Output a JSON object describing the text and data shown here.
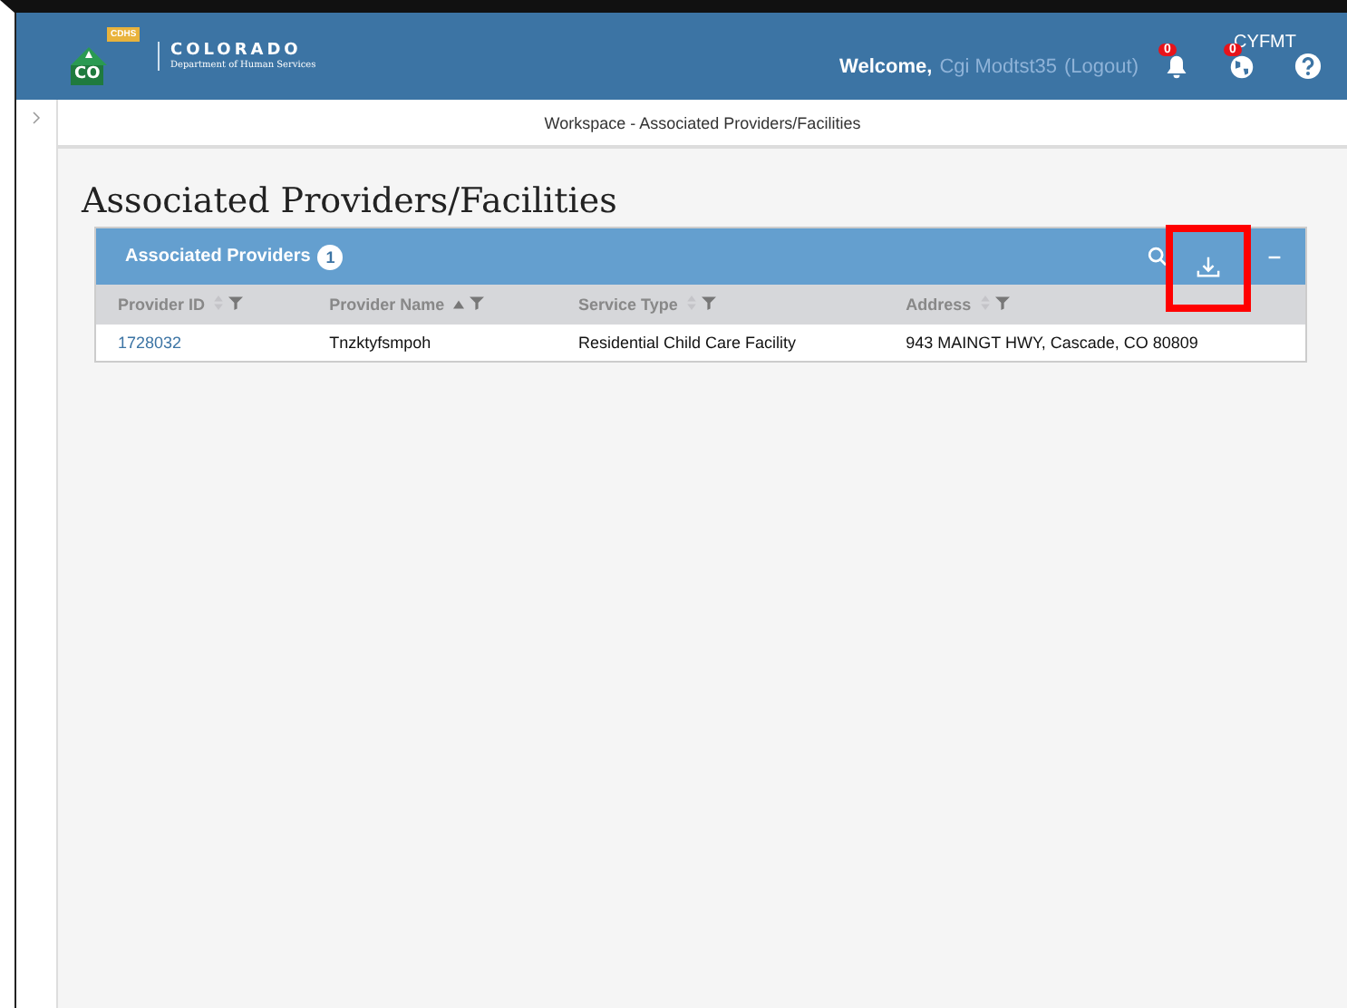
{
  "header": {
    "org_name": "COLORADO",
    "org_subtitle": "Department of Human Services",
    "logo_text": "CO",
    "logo_badge": "CDHS",
    "role": "CYFMT",
    "welcome": "Welcome,",
    "user_name": "Cgi Modtst35",
    "logout": "(Logout)",
    "notifications_count": "0",
    "globe_count": "0"
  },
  "breadcrumb": "Workspace - Associated Providers/Facilities",
  "page_title": "Associated Providers/Facilities",
  "panel": {
    "title": "Associated Providers",
    "count": "1",
    "tools": [
      {
        "kind": "search",
        "highlighted": false
      },
      {
        "kind": "download",
        "highlighted": true
      },
      {
        "kind": "collapse",
        "highlighted": false
      }
    ]
  },
  "table": {
    "columns": [
      {
        "label": "Provider ID",
        "sorted": false
      },
      {
        "label": "Provider Name",
        "sorted": true
      },
      {
        "label": "Service Type",
        "sorted": false
      },
      {
        "label": "Address",
        "sorted": false
      }
    ],
    "rows": [
      {
        "cells": [
          "1728032",
          "Tnzktyfsmpoh",
          "Residential Child Care Facility",
          "943 MAINGT HWY, Cascade, CO 80809"
        ]
      }
    ]
  }
}
